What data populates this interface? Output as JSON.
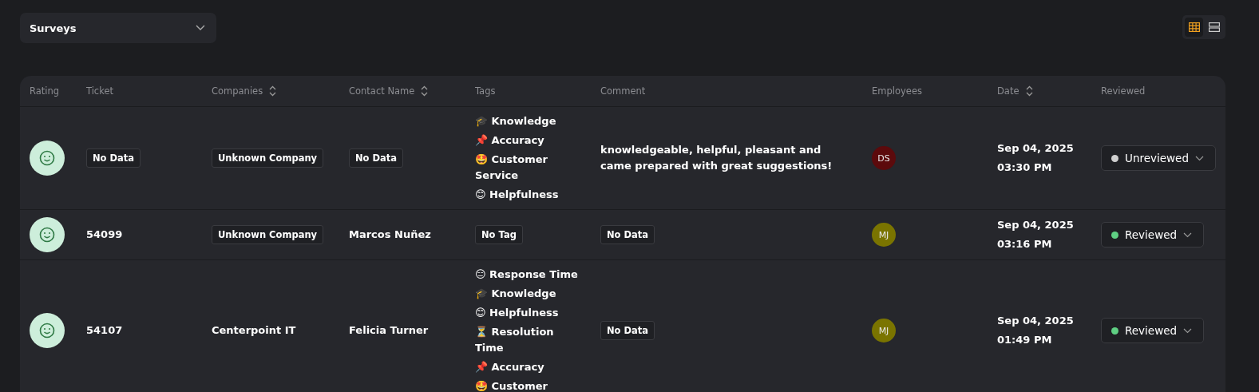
{
  "filter_dropdown": {
    "value": "Surveys"
  },
  "view_toggle": [
    {
      "kind": "table",
      "selected": true
    },
    {
      "kind": "rows",
      "selected": false
    }
  ],
  "table": {
    "columns": [
      {
        "label": "Rating",
        "sortable": false
      },
      {
        "label": "Ticket",
        "sortable": false
      },
      {
        "label": "Companies",
        "sortable": true
      },
      {
        "label": "Contact Name",
        "sortable": true
      },
      {
        "label": "Tags",
        "sortable": false
      },
      {
        "label": "Comment",
        "sortable": false
      },
      {
        "label": "Employees",
        "sortable": false
      },
      {
        "label": "Date",
        "sortable": true
      },
      {
        "label": "Reviewed",
        "sortable": false
      }
    ],
    "rows": [
      {
        "positive": true,
        "ticket": {
          "text": "No Data",
          "kind": "chip"
        },
        "company": {
          "text": "Unknown Company",
          "kind": "chip"
        },
        "contact": {
          "text": "No Data",
          "kind": "chip"
        },
        "tags": [
          {
            "text": "🎓 Knowledge",
            "kind": "text"
          },
          {
            "text": "📌 Accuracy",
            "kind": "text"
          },
          {
            "text": "🤩 Customer Service",
            "kind": "text"
          },
          {
            "text": "😊 Helpfulness",
            "kind": "text"
          }
        ],
        "comment": {
          "text": "knowledgeable, helpful, pleasant and came prepared with great suggestions!",
          "kind": "text"
        },
        "employee": {
          "initials": "DS",
          "color": "#5c0a0c"
        },
        "date": "Sep 04, 2025",
        "time": "03:30 PM",
        "status": {
          "label": "Unreviewed",
          "reviewed": false
        }
      },
      {
        "positive": true,
        "ticket": {
          "text": "54099",
          "kind": "text"
        },
        "company": {
          "text": "Unknown Company",
          "kind": "chip"
        },
        "contact": {
          "text": "Marcos Nuñez",
          "kind": "text"
        },
        "tags": [
          {
            "text": "No Tag",
            "kind": "chip"
          }
        ],
        "comment": {
          "text": "No Data",
          "kind": "chip"
        },
        "employee": {
          "initials": "MJ",
          "color": "#7a7400"
        },
        "date": "Sep 04, 2025",
        "time": "03:16 PM",
        "status": {
          "label": "Reviewed",
          "reviewed": true
        }
      },
      {
        "positive": true,
        "ticket": {
          "text": "54107",
          "kind": "text"
        },
        "company": {
          "text": "Centerpoint IT",
          "kind": "text"
        },
        "contact": {
          "text": "Felicia Turner",
          "kind": "text"
        },
        "tags": [
          {
            "text": "😑 Response Time",
            "kind": "text"
          },
          {
            "text": "🎓 Knowledge",
            "kind": "text"
          },
          {
            "text": "😊 Helpfulness",
            "kind": "text"
          },
          {
            "text": "⏳ Resolution Time",
            "kind": "text"
          },
          {
            "text": "📌 Accuracy",
            "kind": "text"
          },
          {
            "text": "🤩 Customer",
            "kind": "text"
          }
        ],
        "comment": {
          "text": "No Data",
          "kind": "chip"
        },
        "employee": {
          "initials": "MJ",
          "color": "#7a7400"
        },
        "date": "Sep 04, 2025",
        "time": "01:49 PM",
        "status": {
          "label": "Reviewed",
          "reviewed": true
        }
      }
    ]
  }
}
